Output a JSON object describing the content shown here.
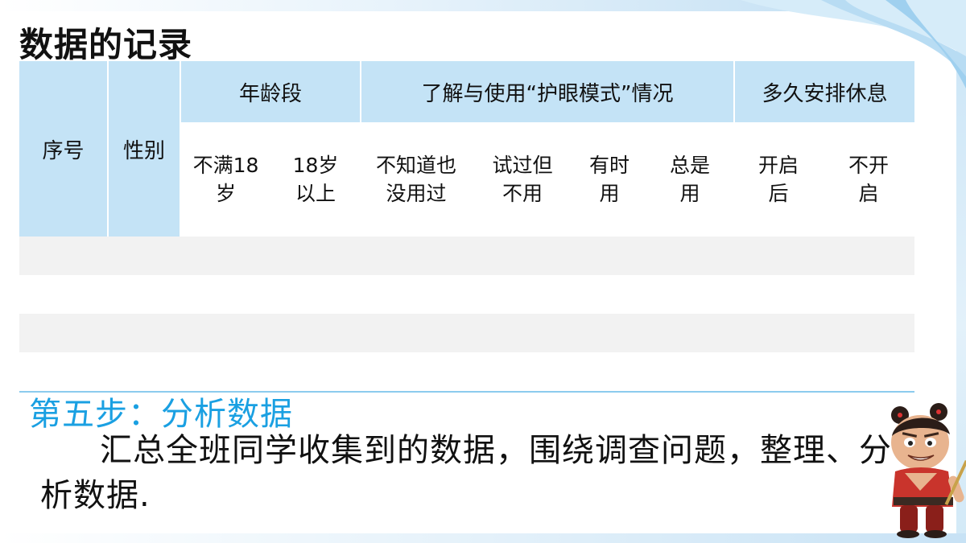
{
  "title": "数据的记录",
  "table": {
    "col_index": "序号",
    "col_gender": "性别",
    "groups": [
      "年龄段",
      "了解与使用“护眼模式”情况",
      "多久安排休息"
    ],
    "sub_headers": [
      {
        "line1": "不满18",
        "line2": "岁"
      },
      {
        "line1": "18岁",
        "line2": "以上"
      },
      {
        "line1": "不知道也",
        "line2": "没用过"
      },
      {
        "line1": "试过但",
        "line2": "不用"
      },
      {
        "line1": "有时",
        "line2": "用"
      },
      {
        "line1": "总是",
        "line2": "用"
      },
      {
        "line1": "开启",
        "line2": "后"
      },
      {
        "line1": "不开",
        "line2": "启"
      }
    ]
  },
  "step": {
    "heading": "第五步：分析数据",
    "body": "汇总全班同学收集到的数据，围绕调查问题，整理、分析数据."
  },
  "colors": {
    "header_blue": "#c4e3f6",
    "step_blue": "#1aa0e2",
    "row_gray": "#f2f2f2"
  },
  "decor": {
    "character": "cartoon-character-illustration"
  }
}
